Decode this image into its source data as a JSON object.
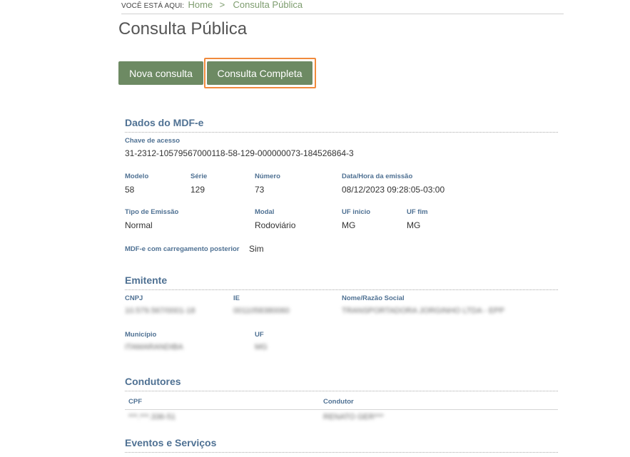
{
  "breadcrumb": {
    "label": "VOCÊ ESTÁ AQUI:",
    "home": "Home",
    "separator": ">",
    "current": "Consulta Pública"
  },
  "page_title": "Consulta Pública",
  "buttons": {
    "nova_consulta": "Nova consulta",
    "consulta_completa": "Consulta Completa"
  },
  "dados_mdfe": {
    "title": "Dados do MDF-e",
    "chave_label": "Chave de acesso",
    "chave_value": "31-2312-10579567000118-58-129-000000073-184526864-3",
    "modelo_label": "Modelo",
    "modelo_value": "58",
    "serie_label": "Série",
    "serie_value": "129",
    "numero_label": "Número",
    "numero_value": "73",
    "emissao_label": "Data/Hora da emissão",
    "emissao_value": "08/12/2023 09:28:05-03:00",
    "tipo_emissao_label": "Tipo de Emissão",
    "tipo_emissao_value": "Normal",
    "modal_label": "Modal",
    "modal_value": "Rodoviário",
    "uf_inicio_label": "UF inicio",
    "uf_inicio_value": "MG",
    "uf_fim_label": "UF fim",
    "uf_fim_value": "MG",
    "carregamento_label": "MDF-e com carregamento posterior",
    "carregamento_value": "Sim"
  },
  "emitente": {
    "title": "Emitente",
    "cnpj_label": "CNPJ",
    "cnpj_value": "10.579.567/0001-18",
    "ie_label": "IE",
    "ie_value": "0011058380060",
    "nome_label": "Nome/Razão Social",
    "nome_value": "TRANSPORTADORA JORGINHO LTDA - EPP",
    "municipio_label": "Município",
    "municipio_value": "ITAMARANDIBA",
    "uf_label": "UF",
    "uf_value": "MG"
  },
  "condutores": {
    "title": "Condutores",
    "cpf_label": "CPF",
    "condutor_label": "Condutor",
    "rows": [
      {
        "cpf": "***.***.336-51",
        "condutor": "RENATO GER***"
      }
    ]
  },
  "eventos": {
    "title": "Eventos e Serviços"
  }
}
